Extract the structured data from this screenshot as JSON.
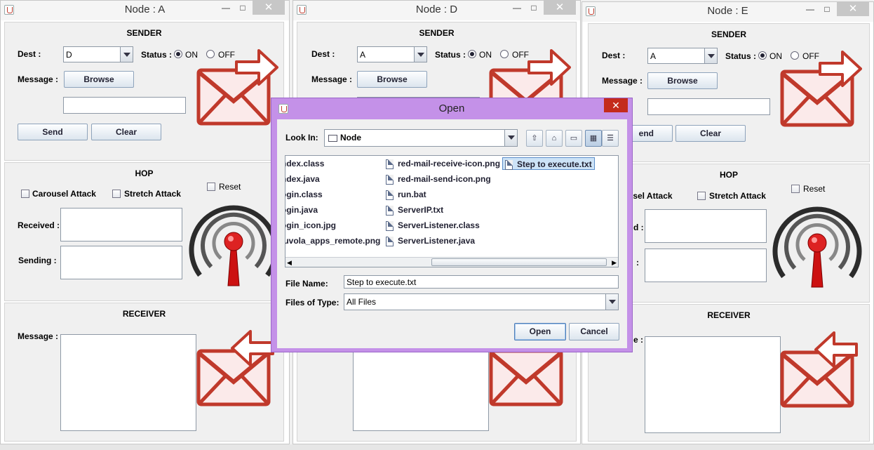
{
  "windows": [
    {
      "title": "Node : A",
      "sender": {
        "title": "SENDER",
        "dest_label": "Dest :",
        "dest_value": "D",
        "status_label": "Status :",
        "on": "ON",
        "off": "OFF",
        "message_label": "Message :",
        "browse": "Browse",
        "send": "Send",
        "clear": "Clear"
      },
      "hop": {
        "title": "HOP",
        "carousel": "Carousel Attack",
        "stretch": "Stretch Attack",
        "reset": "Reset",
        "received": "Received :",
        "sending": "Sending :"
      },
      "receiver": {
        "title": "RECEIVER",
        "message_label": "Message :"
      }
    },
    {
      "title": "Node : D",
      "sender": {
        "title": "SENDER",
        "dest_label": "Dest :",
        "dest_value": "A",
        "status_label": "Status :",
        "on": "ON",
        "off": "OFF",
        "message_label": "Message :",
        "browse": "Browse"
      }
    },
    {
      "title": "Node : E",
      "sender": {
        "title": "SENDER",
        "dest_label": "Dest :",
        "dest_value": "A",
        "status_label": "Status :",
        "on": "ON",
        "off": "OFF",
        "message_label": "Message :",
        "browse": "Browse",
        "send_partial": "end",
        "clear": "Clear"
      },
      "hop": {
        "title": "HOP",
        "carousel_partial": "usel Attack",
        "stretch": "Stretch Attack",
        "reset": "Reset",
        "received_partial": "d :",
        "sending_partial": ":"
      },
      "receiver": {
        "title": "RECEIVER",
        "message_partial": "e :"
      }
    }
  ],
  "window_controls": {
    "minimize": "—",
    "maximize": "□",
    "close": "✕"
  },
  "dialog": {
    "title": "Open",
    "close": "✕",
    "look_in_label": "Look In:",
    "look_in_value": "Node",
    "files_col1": [
      "ndex.class",
      "ndex.java",
      "ogin.class",
      "ogin.java",
      "ogin_icon.jpg",
      "luvola_apps_remote.png"
    ],
    "files_col2": [
      "red-mail-receive-icon.png",
      "red-mail-send-icon.png",
      "run.bat",
      "ServerIP.txt",
      "ServerListener.class",
      "ServerListener.java"
    ],
    "files_col3": [
      "Step to execute.txt"
    ],
    "file_name_label": "File Name:",
    "file_name_value": "Step to execute.txt",
    "files_type_label": "Files of Type:",
    "files_type_value": "All Files",
    "open_button": "Open",
    "cancel_button": "Cancel"
  },
  "colors": {
    "dialog_frame": "#c491e8",
    "mail_red": "#d33b34",
    "antenna_red": "#cc1111"
  }
}
